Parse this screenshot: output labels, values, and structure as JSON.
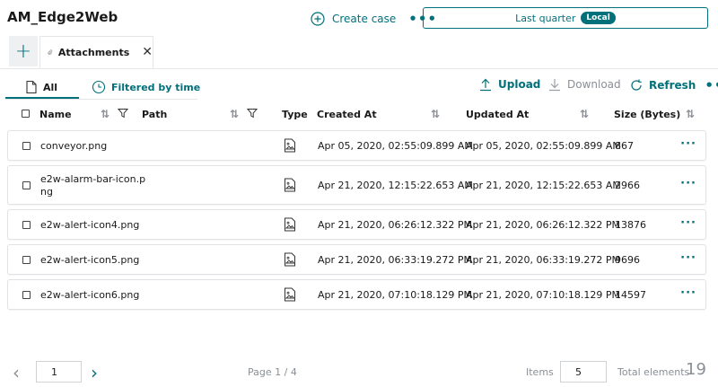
{
  "header": {
    "app_title": "AM_Edge2Web",
    "create_case_label": "Create case",
    "more": "•••",
    "time_range_label": "Last quarter",
    "time_badge": "Local"
  },
  "tabs": {
    "add": "+",
    "attachments_label": "Attachments",
    "close": "✕"
  },
  "subtabs": {
    "all_label": "All",
    "filtered_label": "Filtered by time"
  },
  "toolbar": {
    "upload_label": "Upload",
    "download_label": "Download",
    "refresh_label": "Refresh",
    "more": "•••"
  },
  "table": {
    "columns": {
      "name": "Name",
      "path": "Path",
      "type": "Type",
      "created_at": "Created At",
      "updated_at": "Updated At",
      "size": "Size (Bytes)"
    },
    "rows": [
      {
        "name_line1": "conveyor.png",
        "name_line2": "",
        "created": "Apr 05, 2020, 02:55:09.899 AM",
        "updated": "Apr 05, 2020, 02:55:09.899 AM",
        "size": "867"
      },
      {
        "name_line1": "e2w-alarm-bar-icon.p",
        "name_line2": "ng",
        "created": "Apr 21, 2020, 12:15:22.653 AM",
        "updated": "Apr 21, 2020, 12:15:22.653 AM",
        "size": "2966"
      },
      {
        "name_line1": "e2w-alert-icon4.png",
        "name_line2": "",
        "created": "Apr 21, 2020, 06:26:12.322 PM",
        "updated": "Apr 21, 2020, 06:26:12.322 PM",
        "size": "13876"
      },
      {
        "name_line1": "e2w-alert-icon5.png",
        "name_line2": "",
        "created": "Apr 21, 2020, 06:33:19.272 PM",
        "updated": "Apr 21, 2020, 06:33:19.272 PM",
        "size": "9696"
      },
      {
        "name_line1": "e2w-alert-icon6.png",
        "name_line2": "",
        "created": "Apr 21, 2020, 07:10:18.129 PM",
        "updated": "Apr 21, 2020, 07:10:18.129 PM",
        "size": "14597"
      }
    ],
    "row_more": "···"
  },
  "pager": {
    "prev": "‹",
    "page_value": "1",
    "next": "›",
    "page_info": "Page 1 / 4",
    "items_label": "Items",
    "items_value": "5",
    "total_label": "Total elements",
    "total_value": "19"
  },
  "colors": {
    "accent": "#00707a",
    "muted": "#8a8f96",
    "border": "#e0e2e5"
  }
}
